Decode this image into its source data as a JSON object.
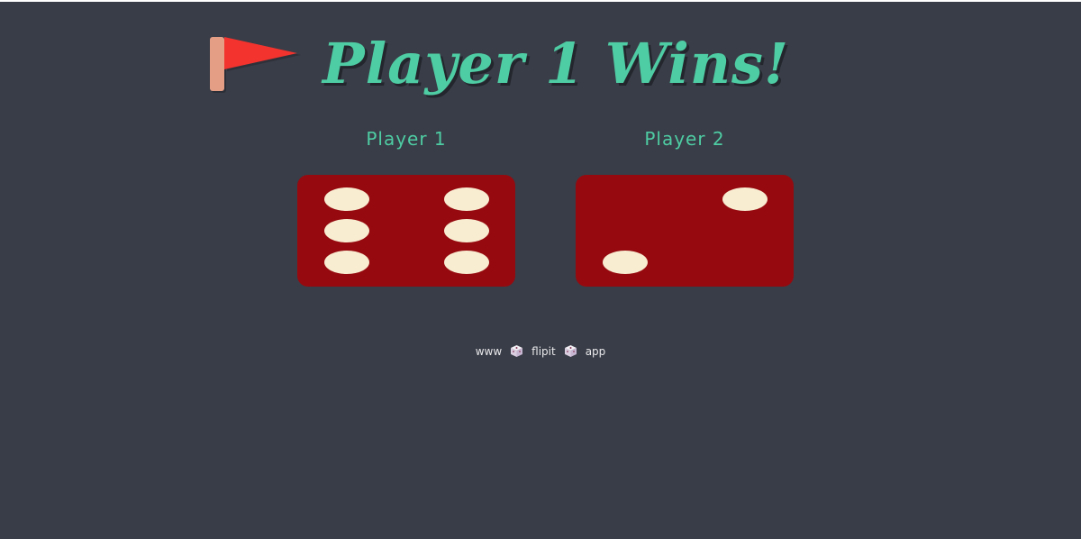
{
  "game": {
    "title": "Player 1 Wins!",
    "winner": "Player 1",
    "title_icon": "red-flag-icon"
  },
  "players": [
    {
      "label": "Player 1",
      "die_value": 6
    },
    {
      "label": "Player 2",
      "die_value": 2
    }
  ],
  "footer": {
    "parts": [
      "www",
      "flipit",
      "app"
    ],
    "separator_icon": "dice-icon"
  },
  "colors": {
    "background": "#393d47",
    "accent": "#4ecca3",
    "die_face": "#960a0f",
    "pip": "#f8ecd1",
    "flag": "#f2332e",
    "flag_pole": "#e59e86"
  }
}
